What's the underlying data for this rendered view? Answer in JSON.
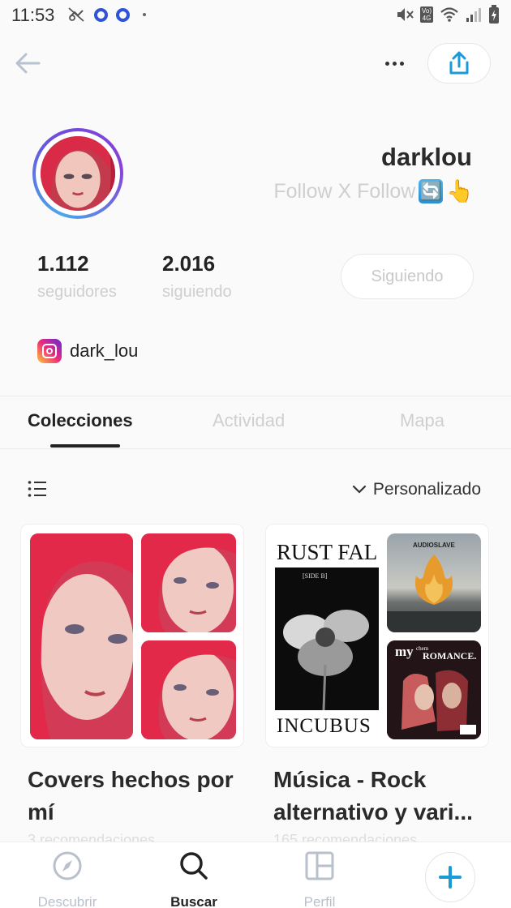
{
  "status_bar": {
    "time": "11:53",
    "network_badge_top": "Vo)",
    "network_badge_bottom": "4G"
  },
  "profile": {
    "username": "darklou",
    "bio": "Follow X Follow",
    "bio_icon_glyph": "🔄",
    "bio_hand_glyph": "👆",
    "followers_count": "1.112",
    "followers_label": "seguidores",
    "following_count": "2.016",
    "following_label": "siguiendo",
    "follow_button": "Siguiendo",
    "instagram_handle": "dark_lou"
  },
  "tabs": [
    {
      "label": "Colecciones",
      "active": true
    },
    {
      "label": "Actividad",
      "active": false
    },
    {
      "label": "Mapa",
      "active": false
    }
  ],
  "toolbar": {
    "sort_label": "Personalizado"
  },
  "collections": [
    {
      "title": "Covers hechos por mí",
      "subtitle": "3 recomendaciones"
    },
    {
      "title": "Música - Rock alternativo y vari...",
      "subtitle": "165 recomendaciones",
      "covers": {
        "incubus_top": "RUST FAL",
        "incubus_side": "[SIDE B]",
        "incubus_bottom": "INCUBUS",
        "audioslave": "AUDIOSLAVE",
        "mcr_line1": "my",
        "mcr_line2": "ROMANCE.",
        "mcr_small": "chem"
      }
    }
  ],
  "bottom_nav": [
    {
      "label": "Descubrir",
      "active": false
    },
    {
      "label": "Buscar",
      "active": true
    },
    {
      "label": "Perfil",
      "active": false
    }
  ],
  "colors": {
    "accent": "#1a9ad6",
    "brand_blue": "#2f55d4",
    "text_dark": "#222222",
    "text_muted": "#cfcfcf"
  }
}
